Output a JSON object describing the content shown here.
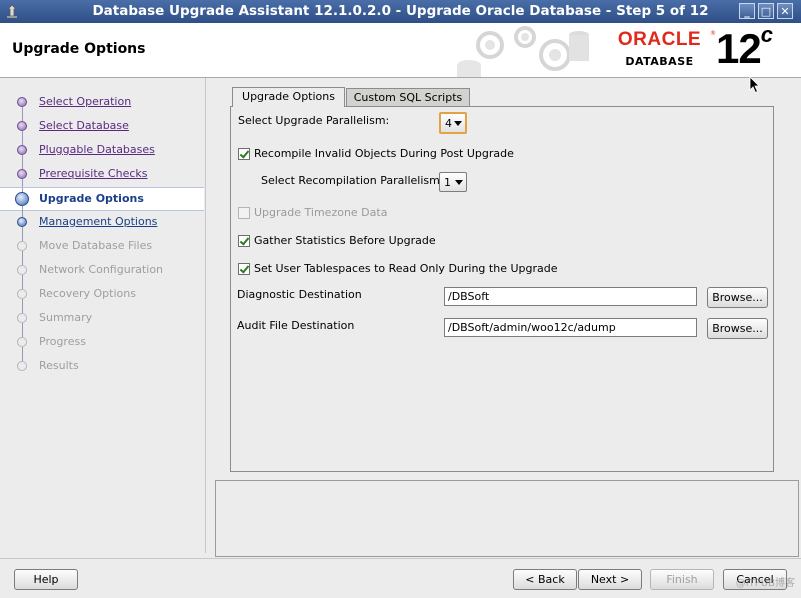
{
  "window": {
    "title": "Database Upgrade Assistant 12.1.0.2.0 - Upgrade Oracle Database - Step 5 of 12",
    "buttons": {
      "minimize": "_",
      "maximize": "□",
      "close": "✕"
    }
  },
  "header": {
    "page_title": "Upgrade Options",
    "logo": {
      "brand": "ORACLE",
      "product": "DATABASE",
      "version": "12",
      "version_suffix": "c"
    }
  },
  "sidebar": {
    "steps": [
      {
        "label": "Select Operation",
        "state": "done"
      },
      {
        "label": "Select Database",
        "state": "done"
      },
      {
        "label": "Pluggable Databases",
        "state": "done"
      },
      {
        "label": "Prerequisite Checks",
        "state": "done"
      },
      {
        "label": "Upgrade Options",
        "state": "current"
      },
      {
        "label": "Management Options",
        "state": "next"
      },
      {
        "label": "Move Database Files",
        "state": "disabled"
      },
      {
        "label": "Network Configuration",
        "state": "disabled"
      },
      {
        "label": "Recovery Options",
        "state": "disabled"
      },
      {
        "label": "Summary",
        "state": "disabled"
      },
      {
        "label": "Progress",
        "state": "disabled"
      },
      {
        "label": "Results",
        "state": "disabled"
      }
    ]
  },
  "tabs": {
    "upgrade_options": "Upgrade Options",
    "custom_sql": "Custom SQL Scripts"
  },
  "form": {
    "parallelism_label": "Select Upgrade Parallelism:",
    "parallelism_value": "4",
    "recompile_label": "Recompile Invalid Objects During Post Upgrade",
    "recompile_checked": true,
    "recomp_parallelism_label": "Select Recompilation Parallelism:",
    "recomp_parallelism_value": "1",
    "timezone_label": "Upgrade Timezone Data",
    "timezone_checked": false,
    "gather_stats_label": "Gather Statistics Before Upgrade",
    "gather_stats_checked": true,
    "readonly_label": "Set User Tablespaces to Read Only During the Upgrade",
    "readonly_checked": true,
    "diag_label": "Diagnostic Destination",
    "diag_value": "/DBSoft",
    "audit_label": "Audit File Destination",
    "audit_value": "/DBSoft/admin/woo12c/adump",
    "browse_label": "Browse..."
  },
  "footer": {
    "help": "Help",
    "back": "< Back",
    "next": "Next >",
    "finish": "Finish",
    "cancel": "Cancel"
  },
  "watermark": "@ITPUB博客",
  "colors": {
    "titlebar": "#2e4f86",
    "oracle_red": "#e2281b",
    "focus_orange": "#e3a244"
  }
}
